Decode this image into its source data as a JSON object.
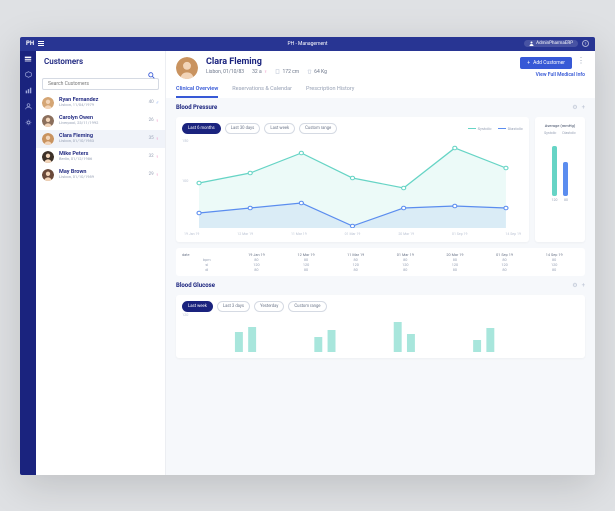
{
  "topbar": {
    "logo": "PH",
    "title": "PH - Management",
    "user": "AdminPharmaERP"
  },
  "sidebar": {
    "title": "Customers",
    "search_placeholder": "Search Customers",
    "customers": [
      {
        "name": "Ryan Fernandez",
        "sub": "Lisbon, 11/04/1979",
        "age": "40",
        "gender": "m",
        "color": "#d4a574"
      },
      {
        "name": "Carolyn Owen",
        "sub": "Liverpool, 23/11/1992",
        "age": "26",
        "gender": "f",
        "color": "#8b6f5c"
      },
      {
        "name": "Clara Fleming",
        "sub": "Lisbon, 01/10/1983",
        "age": "35",
        "gender": "f",
        "color": "#c9935f",
        "selected": true
      },
      {
        "name": "Mike Peters",
        "sub": "Berlin, 01/12/1986",
        "age": "32",
        "gender": "f",
        "color": "#3d3128"
      },
      {
        "name": "May Brown",
        "sub": "Lisbon, 01/10/1989",
        "age": "29",
        "gender": "f",
        "color": "#6b4a3a"
      }
    ]
  },
  "patient": {
    "name": "Clara Fleming",
    "sub": "Lisbon, 01/10/83",
    "age": "32 a",
    "height": "172 cm",
    "weight": "64 Kg",
    "add_btn": "Add Customer",
    "link": "View Full Medical Info"
  },
  "tabs": [
    "Clinical Overview",
    "Reservations & Calendar",
    "Prescription History"
  ],
  "bp": {
    "title": "Blood Pressure",
    "ranges": [
      "Last 6 months",
      "Last 30 days",
      "Last week",
      "Custom range"
    ],
    "legend": {
      "s": "Systolic",
      "d": "Diastolic"
    },
    "side_title": "Average (mmHg)",
    "side_labels": {
      "s": "Systolic",
      "d": "Diastolic"
    },
    "side_vals": {
      "s": "120",
      "d": "80"
    }
  },
  "chart_data": {
    "type": "line",
    "x": [
      "19 Jan 19",
      "12 Mar 19",
      "11 Mar 19",
      "01 Mar 19",
      "20 Mar 19",
      "01 Sep 19",
      "14 Sep 19"
    ],
    "series": [
      {
        "name": "Systolic",
        "values": [
          105,
          115,
          135,
          110,
          100,
          140,
          120
        ],
        "color": "#66d4c5"
      },
      {
        "name": "Diastolic",
        "values": [
          75,
          80,
          85,
          62,
          80,
          82,
          80
        ],
        "color": "#5b8def"
      }
    ],
    "ylim": [
      60,
      150
    ],
    "table": {
      "rows": [
        "bpm",
        "sl",
        "dl"
      ],
      "data": [
        [
          "80",
          "80",
          "80",
          "80",
          "80",
          "80",
          "80"
        ],
        [
          "120",
          "120",
          "120",
          "120",
          "120",
          "120",
          "120"
        ],
        [
          "80",
          "80",
          "80",
          "80",
          "80",
          "80",
          "80"
        ]
      ]
    }
  },
  "glucose": {
    "title": "Blood Glucose",
    "ranges": [
      "Last week",
      "Last 3 days",
      "Yesterday",
      "Custom range"
    ],
    "ylab": "120"
  }
}
